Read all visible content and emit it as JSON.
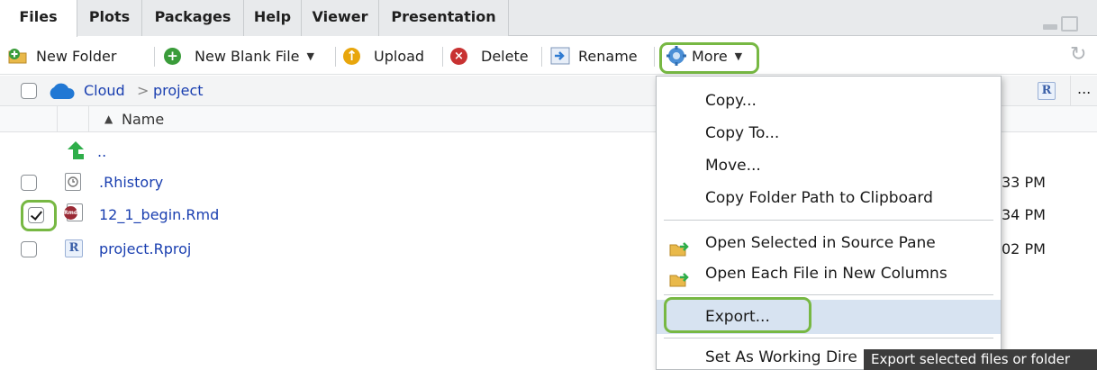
{
  "tabs": [
    {
      "label": "Files"
    },
    {
      "label": "Plots"
    },
    {
      "label": "Packages"
    },
    {
      "label": "Help"
    },
    {
      "label": "Viewer"
    },
    {
      "label": "Presentation"
    }
  ],
  "toolbar": {
    "new_folder": "New Folder",
    "new_blank_file": "New Blank File",
    "upload": "Upload",
    "delete": "Delete",
    "rename": "Rename",
    "more": "More"
  },
  "path": {
    "root": "Cloud",
    "separator": ">",
    "current": "project"
  },
  "overflow": "...",
  "columns": {
    "name": "Name",
    "sort_indicator": "▲"
  },
  "files": [
    {
      "name": "..",
      "type": "parent"
    },
    {
      "name": ".Rhistory",
      "type": "history",
      "modified": "33 PM",
      "checked": false
    },
    {
      "name": "12_1_begin.Rmd",
      "type": "rmd",
      "rmd_badge": "Rmd",
      "modified": "34 PM",
      "checked": true
    },
    {
      "name": "project.Rproj",
      "type": "rproj",
      "modified": "02 PM",
      "checked": false
    }
  ],
  "menu": {
    "items": [
      {
        "label": "Copy..."
      },
      {
        "label": "Copy To..."
      },
      {
        "label": "Move..."
      },
      {
        "label": "Copy Folder Path to Clipboard"
      },
      {
        "label": "Open Selected in Source Pane"
      },
      {
        "label": "Open Each File in New Columns"
      },
      {
        "label": "Export..."
      },
      {
        "label": "Set As Working Dire"
      }
    ]
  },
  "tooltip": "Export selected files or folder",
  "icons": {
    "r_label": "R"
  },
  "colors": {
    "highlight_ring": "#77b843",
    "menu_highlight": "#d7e3f1",
    "link": "#1a3fb0"
  }
}
